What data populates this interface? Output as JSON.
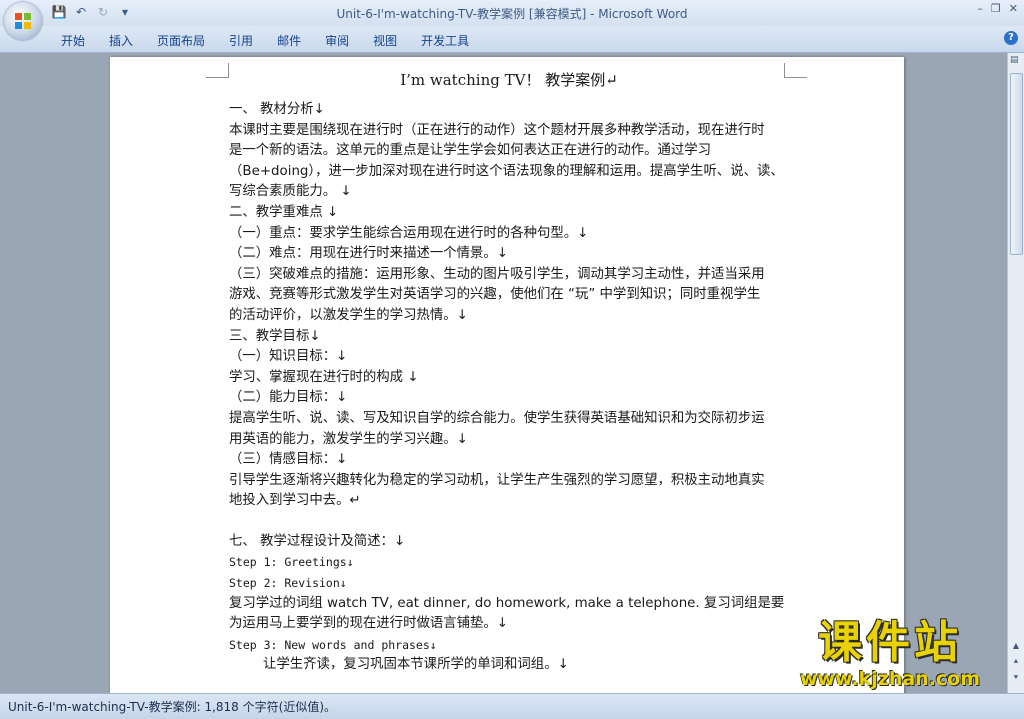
{
  "window": {
    "doc_title": "Unit-6-I'm-watching-TV-教学案例 [兼容模式]",
    "separator": " - ",
    "app_name": "Microsoft Word",
    "controls": {
      "minimize": "–",
      "restore": "❐",
      "close": "✕"
    }
  },
  "quick_access": {
    "save": "💾",
    "undo": "↶",
    "redo": "↻",
    "more": "▾"
  },
  "ribbon": {
    "tabs": [
      "开始",
      "插入",
      "页面布局",
      "引用",
      "邮件",
      "审阅",
      "视图",
      "开发工具"
    ],
    "help": "?"
  },
  "document": {
    "title": "I’m watching TV！  教学案例↵",
    "paragraphs": [
      "一、   教材分析↓",
      "本课时主要是围绕现在进行时（正在进行的动作）这个题材开展多种教学活动，现在进行时",
      "是一个新的语法。这单元的重点是让学生学会如何表达正在进行的动作。通过学习",
      "（Be+doing），进一步加深对现在进行时这个语法现象的理解和运用。提高学生听、说、读、",
      "写综合素质能力。 ↓",
      "二、教学重难点 ↓",
      "（一）重点：要求学生能综合运用现在进行时的各种句型。↓",
      "（二）难点：用现在进行时来描述一个情景。↓",
      "（三）突破难点的措施：运用形象、生动的图片吸引学生，调动其学习主动性，并适当采用",
      "游戏、竞赛等形式激发学生对英语学习的兴趣，使他们在 “玩” 中学到知识；同时重视学生",
      "的活动评价，以激发学生的学习热情。↓",
      "三、教学目标↓",
      "（一）知识目标：↓",
      "学习、掌握现在进行时的构成 ↓",
      "（二）能力目标：↓",
      "提高学生听、说、读、写及知识自学的综合能力。使学生获得英语基础知识和为交际初步运",
      "用英语的能力，激发学生的学习兴趣。↓",
      "（三）情感目标：↓",
      "引导学生逐渐将兴趣转化为稳定的学习动机，让学生产生强烈的学习愿望，积极主动地真实",
      "地投入到学习中去。↵"
    ],
    "section7": "七、  教学过程设计及简述：↓",
    "steps": [
      "Step 1: Greetings↓",
      "Step 2: Revision↓"
    ],
    "review_lines": [
      "复习学过的词组 watch TV, eat dinner, do homework, make a telephone. 复习词组是要",
      "为运用马上要学到的现在进行时做语言铺垫。↓"
    ],
    "step3": "Step 3: New words and phrases↓",
    "step3_line": "让学生齐读，复习巩固本节课所学的单词和词组。↓"
  },
  "status_bar": {
    "text": "Unit-6-I'm-watching-TV-教学案例: 1,818 个字符(近似值)。"
  },
  "watermark": {
    "chars": "课件站",
    "url": "www.kjzhan.com"
  },
  "scrollbar": {
    "up": "▲",
    "down": "▼",
    "prev_page": "⯅",
    "next_page": "⯆"
  }
}
